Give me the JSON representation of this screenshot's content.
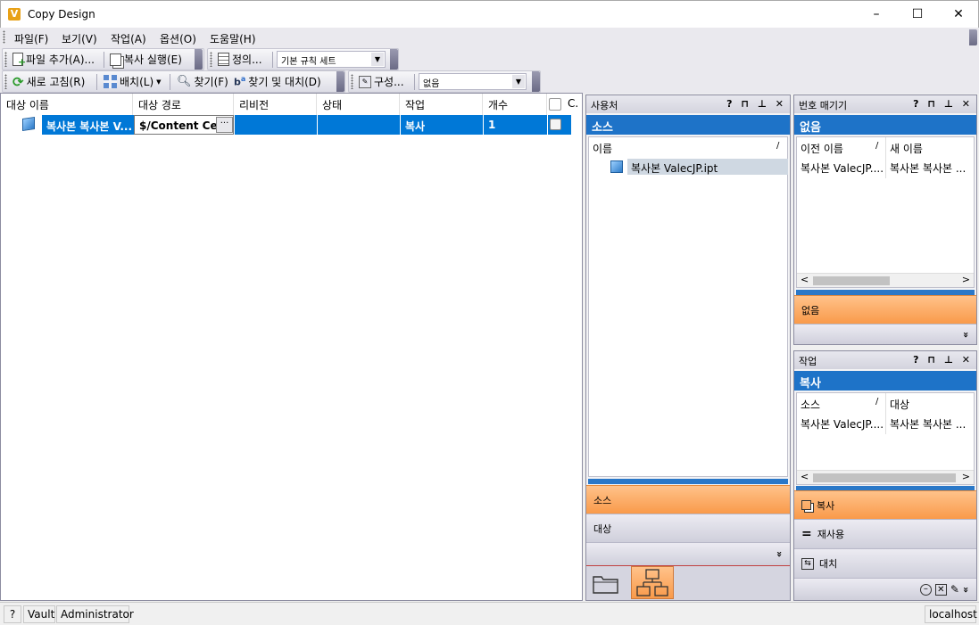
{
  "window": {
    "title": "Copy Design",
    "minimize": "–",
    "maximize": "☐",
    "close": "✕",
    "logo": "V"
  },
  "menu": [
    "파일(F)",
    "보기(V)",
    "작업(A)",
    "옵션(O)",
    "도움말(H)"
  ],
  "toolbar1": {
    "add_file": "파일 추가(A)...",
    "run_copy": "복사 실행(E)",
    "define": "정의...",
    "ruleset_value": "기본 규칙 세트"
  },
  "toolbar2": {
    "refresh": "새로 고침(R)",
    "layout": "배치(L)",
    "find": "찾기(F)",
    "find_replace": "찾기 및 대치(D)",
    "configure": "구성...",
    "filter_value": "없음"
  },
  "grid": {
    "columns": [
      "대상 이름",
      "대상 경로",
      "리비전",
      "상태",
      "작업",
      "개수",
      "C."
    ],
    "rows": [
      {
        "name": "복사본 복사본 V...",
        "path": "$/Content Ce...",
        "path_button": "···",
        "revision": "",
        "state": "",
        "action": "복사",
        "count": "1"
      }
    ]
  },
  "usage_panel": {
    "title": "사용처",
    "band": "소스",
    "col_header": "이름",
    "sort_mark": "/",
    "item": "복사본 ValecJP.ipt",
    "sections": [
      "소스",
      "대상"
    ],
    "more": "»"
  },
  "numbering_panel": {
    "title": "번호 매기기",
    "band": "없음",
    "col_old": "이전 이름",
    "col_new": "새 이름",
    "sort_mark": "/",
    "row_old": "복사본 ValecJP....",
    "row_new": "복사본 복사본 ...",
    "section": "없음",
    "more": "»"
  },
  "action_panel": {
    "title": "작업",
    "band": "복사",
    "col_src": "소스",
    "col_dst": "대상",
    "sort_mark": "/",
    "row_src": "복사본 ValecJP....",
    "row_dst": "복사본 복사본 ...",
    "sections": [
      "복사",
      "재사용",
      "대치"
    ],
    "more": "»"
  },
  "panel_buttons": "? ⊓ ⊥ ✕",
  "scroll": {
    "left": "<",
    "right": ">"
  },
  "status": {
    "help": "?",
    "vault": "Vault",
    "user": "Administrator",
    "server": "localhost"
  },
  "colors": {
    "selection": "#0078d7",
    "band_blue": "#1e73c8",
    "orange_section": "#f99a4a"
  }
}
